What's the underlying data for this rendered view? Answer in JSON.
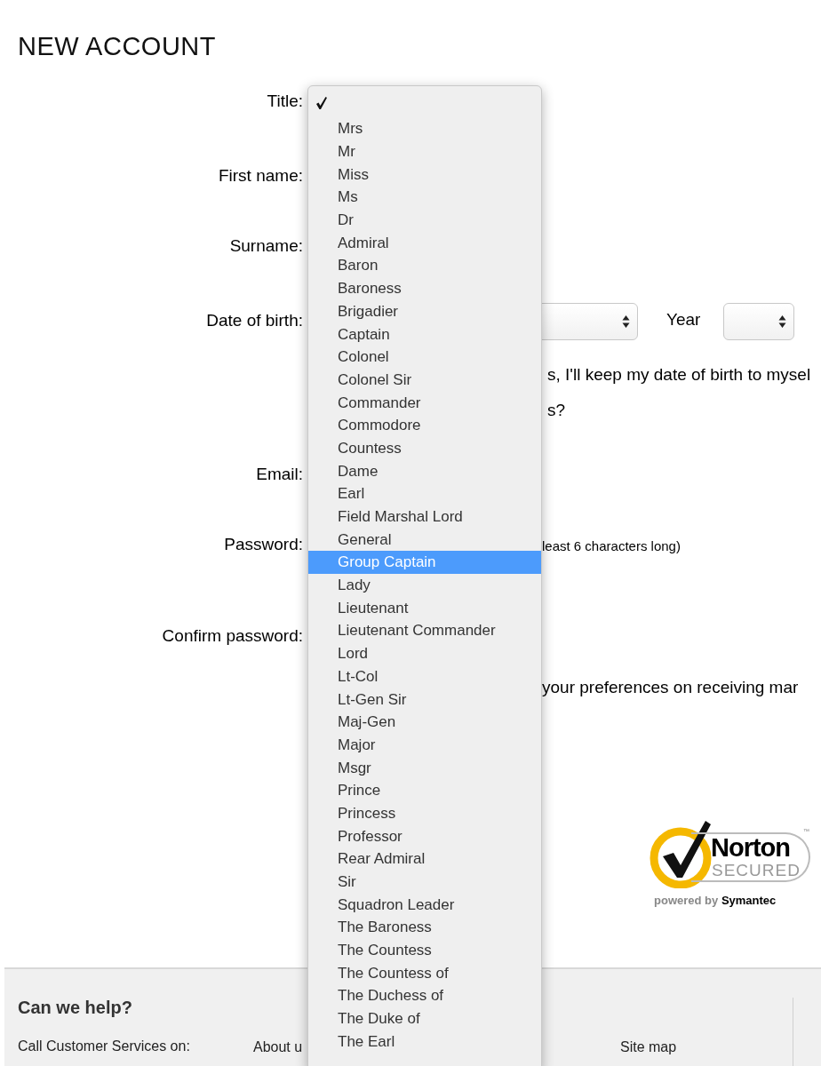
{
  "heading": "NEW ACCOUNT",
  "fields": [
    {
      "kind": "title",
      "label": "Title:"
    },
    {
      "kind": "text",
      "label": "First name:"
    },
    {
      "kind": "text",
      "label": "Surname:"
    },
    {
      "kind": "dob",
      "label": "Date of birth:",
      "year_label": "Year",
      "private_note": "s, I'll keep my date of birth to mysel",
      "question": "s?"
    },
    {
      "kind": "text",
      "label": "Email:"
    },
    {
      "kind": "password",
      "label": "Password:",
      "hint": "least 6 characters long)"
    },
    {
      "kind": "confirm",
      "label": "Confirm password:",
      "note": "your preferences on receiving mar"
    }
  ],
  "title_menu": {
    "blank_option": {
      "checked": true
    },
    "options": [
      {
        "label": "Mrs",
        "selected": false
      },
      {
        "label": "Mr",
        "selected": false
      },
      {
        "label": "Miss",
        "selected": false
      },
      {
        "label": "Ms",
        "selected": false
      },
      {
        "label": "Dr",
        "selected": false
      },
      {
        "label": "Admiral",
        "selected": false
      },
      {
        "label": "Baron",
        "selected": false
      },
      {
        "label": "Baroness",
        "selected": false
      },
      {
        "label": "Brigadier",
        "selected": false
      },
      {
        "label": "Captain",
        "selected": false
      },
      {
        "label": "Colonel",
        "selected": false
      },
      {
        "label": "Colonel Sir",
        "selected": false
      },
      {
        "label": "Commander",
        "selected": false
      },
      {
        "label": "Commodore",
        "selected": false
      },
      {
        "label": "Countess",
        "selected": false
      },
      {
        "label": "Dame",
        "selected": false
      },
      {
        "label": "Earl",
        "selected": false
      },
      {
        "label": "Field Marshal Lord",
        "selected": false
      },
      {
        "label": "General",
        "selected": false
      },
      {
        "label": "Group Captain",
        "selected": true
      },
      {
        "label": "Lady",
        "selected": false
      },
      {
        "label": "Lieutenant",
        "selected": false
      },
      {
        "label": "Lieutenant Commander",
        "selected": false
      },
      {
        "label": "Lord",
        "selected": false
      },
      {
        "label": "Lt-Col",
        "selected": false
      },
      {
        "label": "Lt-Gen Sir",
        "selected": false
      },
      {
        "label": "Maj-Gen",
        "selected": false
      },
      {
        "label": "Major",
        "selected": false
      },
      {
        "label": "Msgr",
        "selected": false
      },
      {
        "label": "Prince",
        "selected": false
      },
      {
        "label": "Princess",
        "selected": false
      },
      {
        "label": "Professor",
        "selected": false
      },
      {
        "label": "Rear Admiral",
        "selected": false
      },
      {
        "label": "Sir",
        "selected": false
      },
      {
        "label": "Squadron Leader",
        "selected": false
      },
      {
        "label": "The Baroness",
        "selected": false
      },
      {
        "label": "The Countess",
        "selected": false
      },
      {
        "label": "The Countess of",
        "selected": false
      },
      {
        "label": "The Duchess of",
        "selected": false
      },
      {
        "label": "The Duke of",
        "selected": false
      },
      {
        "label": "The Earl",
        "selected": false
      }
    ]
  },
  "badge": {
    "brand": "Norton",
    "tm": "™",
    "secured": "SECURED",
    "powered_by": "powered by",
    "company": "Symantec"
  },
  "footer": {
    "heading": "Can we help?",
    "call_text": "Call Customer Services on:",
    "links": [
      "About u",
      "Site map"
    ]
  }
}
